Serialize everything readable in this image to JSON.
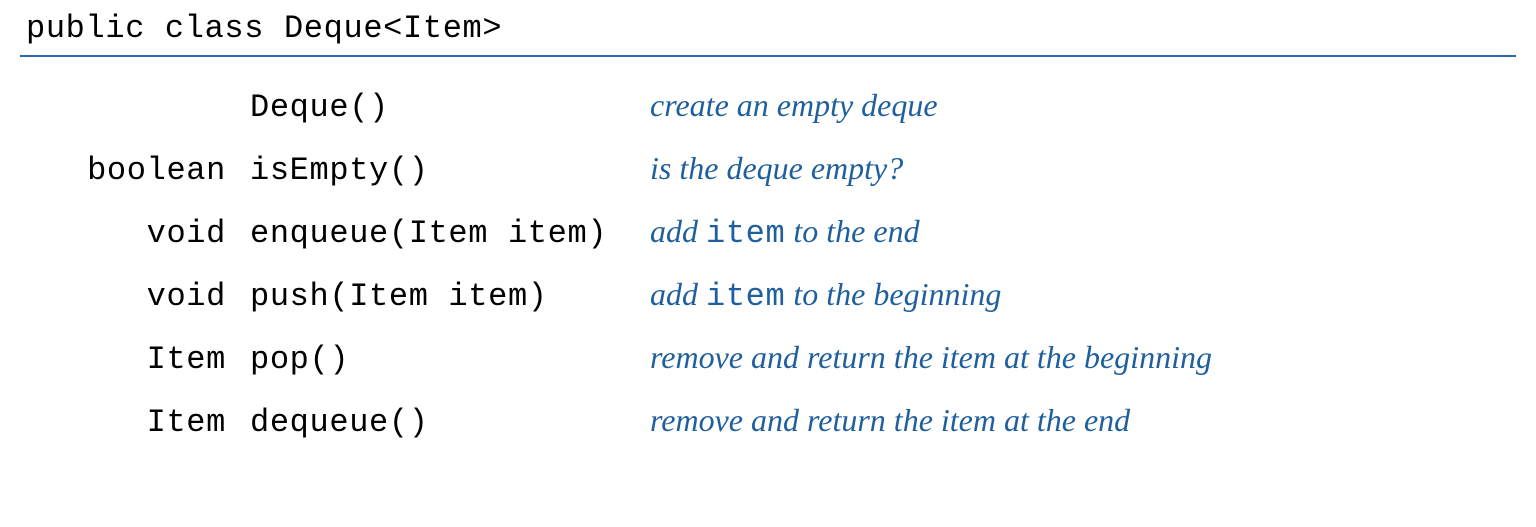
{
  "classDeclaration": "public class Deque<Item>",
  "methods": [
    {
      "returnType": "",
      "signature": "Deque()",
      "descParts": [
        {
          "text": "create an empty deque",
          "code": false
        }
      ]
    },
    {
      "returnType": "boolean",
      "signature": "isEmpty()",
      "descParts": [
        {
          "text": "is the deque empty?",
          "code": false
        }
      ]
    },
    {
      "returnType": "void",
      "signature": "enqueue(Item item)",
      "descParts": [
        {
          "text": "add ",
          "code": false
        },
        {
          "text": "item",
          "code": true
        },
        {
          "text": " to the end",
          "code": false
        }
      ]
    },
    {
      "returnType": "void",
      "signature": "push(Item item)",
      "descParts": [
        {
          "text": "add ",
          "code": false
        },
        {
          "text": "item",
          "code": true
        },
        {
          "text": " to the beginning",
          "code": false
        }
      ]
    },
    {
      "returnType": "Item",
      "signature": "pop()",
      "descParts": [
        {
          "text": "remove and return the item at the beginning",
          "code": false
        }
      ]
    },
    {
      "returnType": "Item",
      "signature": "dequeue()",
      "descParts": [
        {
          "text": "remove and return the item at the end",
          "code": false
        }
      ]
    }
  ]
}
